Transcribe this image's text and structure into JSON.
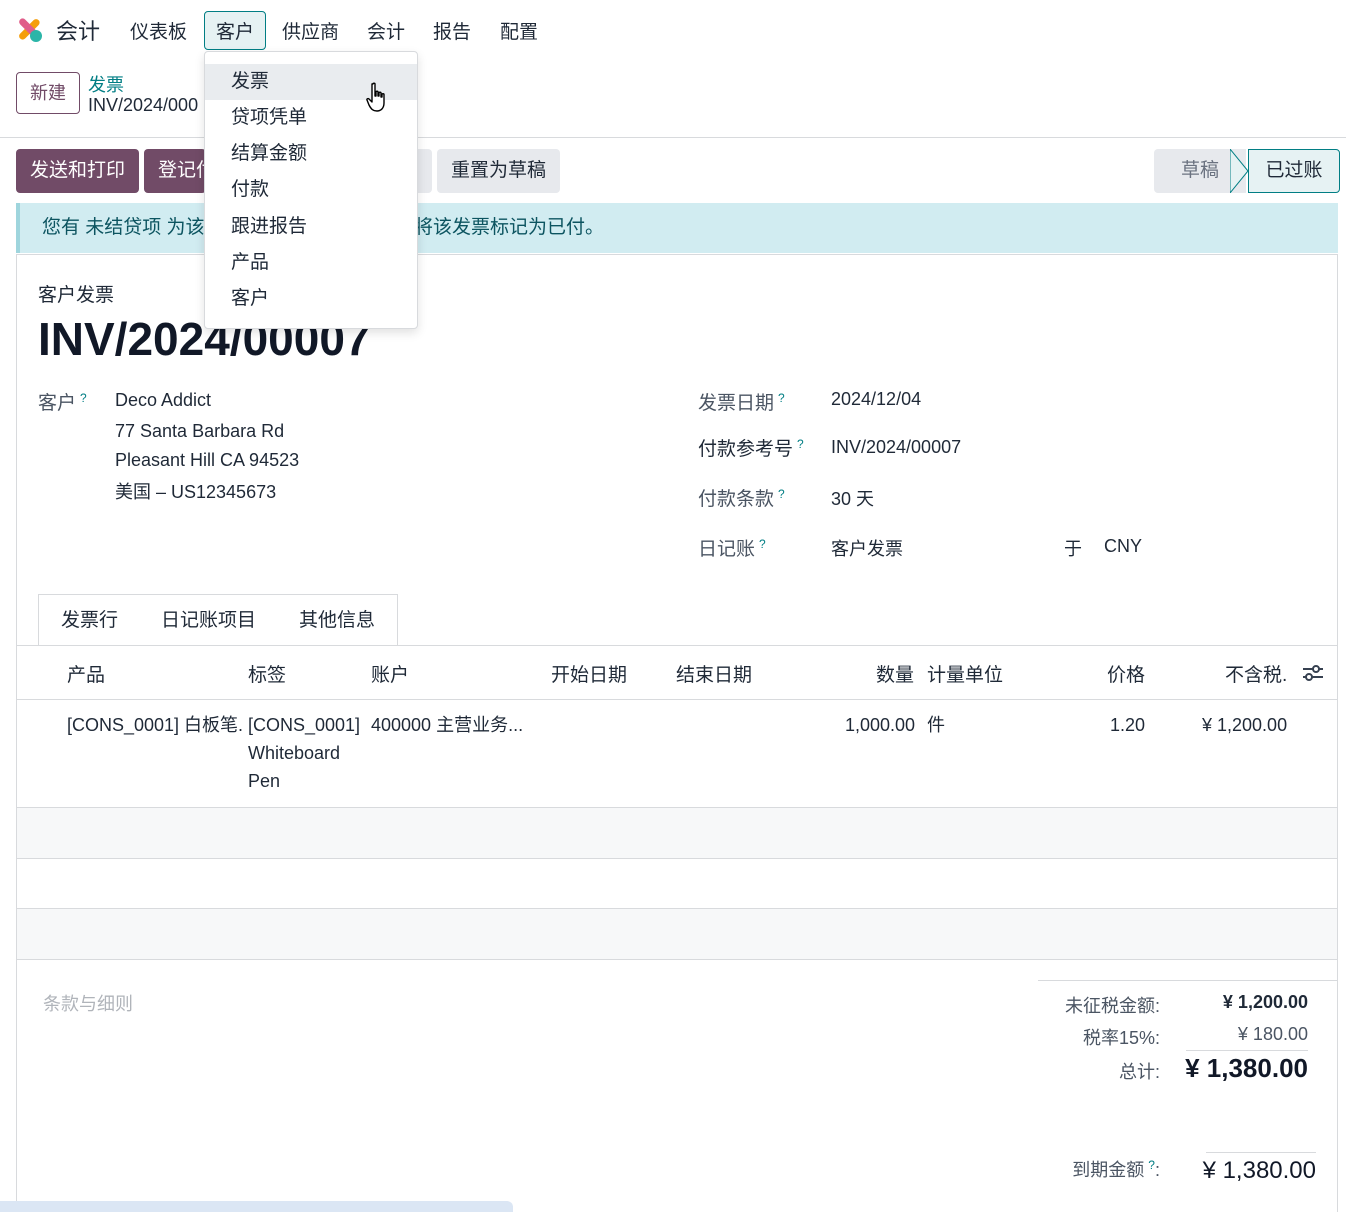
{
  "nav": {
    "app_name": "会计",
    "items": [
      "仪表板",
      "客户",
      "供应商",
      "会计",
      "报告",
      "配置"
    ],
    "active": "客户"
  },
  "breadcrumb": {
    "new_button": "新建",
    "parent": "发票",
    "current": "INV/2024/000"
  },
  "actions": {
    "send_print": "发送和打印",
    "register_payment": "登记付",
    "reset_draft": "重置为草稿"
  },
  "status": {
    "draft": "草稿",
    "posted": "已过账"
  },
  "alert": {
    "left_text": "您有 未结贷项 为该",
    "right_text": "将该发票标记为已付。"
  },
  "form": {
    "doc_type": "客户发票",
    "doc_number": "INV/2024/00007",
    "customer_label": "客户",
    "customer_name": "Deco Addict",
    "address_line1": "77 Santa Barbara Rd",
    "address_line2": "Pleasant Hill CA 94523",
    "address_line3": "美国 – US12345673",
    "invoice_date_label": "发票日期",
    "invoice_date": "2024/12/04",
    "payment_ref_label": "付款参考号",
    "payment_ref": "INV/2024/00007",
    "payment_terms_label": "付款条款",
    "payment_terms": "30 天",
    "journal_label": "日记账",
    "journal": "客户发票",
    "currency_in": "于",
    "currency": "CNY",
    "help_marker": "?"
  },
  "tabs": [
    "发票行",
    "日记账项目",
    "其他信息"
  ],
  "table": {
    "headers": {
      "product": "产品",
      "label": "标签",
      "account": "账户",
      "start_date": "开始日期",
      "end_date": "结束日期",
      "quantity": "数量",
      "uom": "计量单位",
      "price": "价格",
      "subtotal": "不含税."
    },
    "rows": [
      {
        "product": "[CONS_0001] 白板笔.",
        "label_line1": "[CONS_0001]",
        "label_line2": "Whiteboard",
        "label_line3": "Pen",
        "account": "400000 主营业务...",
        "quantity": "1,000.00",
        "uom": "件",
        "price": "1.20",
        "subtotal": "¥ 1,200.00"
      }
    ]
  },
  "terms_placeholder": "条款与细则",
  "totals": {
    "untaxed_label": "未征税金额:",
    "untaxed": "¥ 1,200.00",
    "tax_label": "税率15%:",
    "tax": "¥ 180.00",
    "total_label": "总计:",
    "total": "¥ 1,380.00",
    "due_label": "到期金额",
    "due_colon": ":",
    "due": "¥ 1,380.00"
  },
  "dropdown": {
    "items": [
      "发票",
      "贷项凭单",
      "结算金额",
      "付款",
      "跟进报告",
      "产品",
      "客户"
    ],
    "hovered": "发票"
  },
  "colors": {
    "brand": "#714b67",
    "accent": "#017e84",
    "alert_bg": "#d1ecf1"
  }
}
